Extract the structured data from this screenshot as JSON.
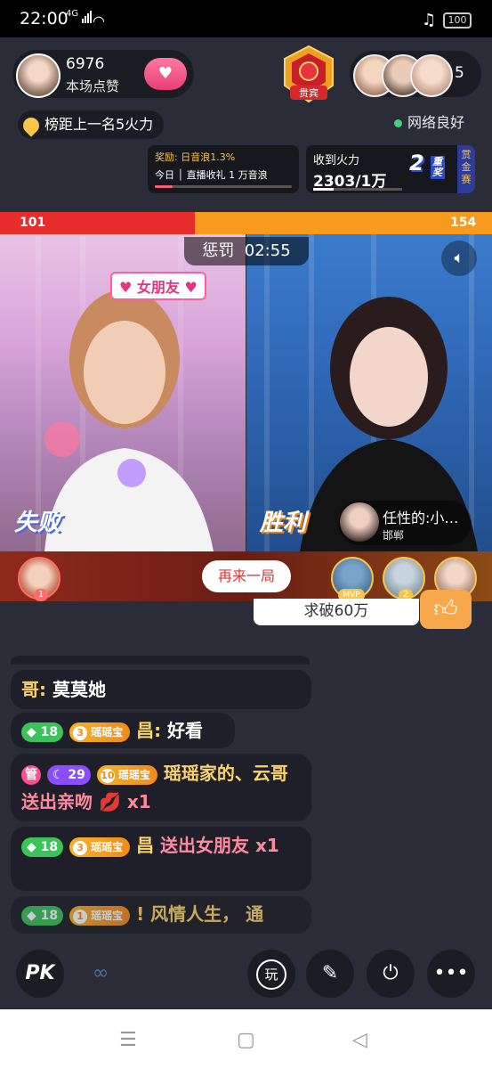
{
  "status_bar": {
    "time": "22:00",
    "network": "4G",
    "battery": "100"
  },
  "host": {
    "likes": "6976",
    "likes_label": "本场点赞"
  },
  "rank_badge": {
    "label": "贵宾"
  },
  "viewers": {
    "count": "5"
  },
  "fire_gap": "榜距上一名5火力",
  "network_status": "网络良好",
  "reward_card": {
    "line1": "奖励: 日音浪1.3%",
    "line2_a": "今日",
    "line2_b": "直播收礼 1 万音浪",
    "progress": 0.13
  },
  "fire_card": {
    "label": "收到火力",
    "value": "2303/1万",
    "double_label": "2",
    "double_suffix": "重奖",
    "bounty_label": "赏金赛",
    "progress": 0.23
  },
  "pk": {
    "left_score": "101",
    "right_score": "154",
    "penalty_label": "惩罚",
    "timer": "02:55"
  },
  "left_video": {
    "tag": "女朋友",
    "stamp": "失败"
  },
  "right_video": {
    "stamp": "胜利",
    "mvp_name": "任性的:小…",
    "mvp_location": "邯郸",
    "mvp_badge": "MVP"
  },
  "result_bar": {
    "rematch_label": "再来一局",
    "left_rank": "1",
    "winners": [
      "1",
      "2",
      "3"
    ]
  },
  "target_banner": "求破60万",
  "chat": [
    {
      "name": "哥:",
      "text": " 莫莫她"
    },
    {
      "level": "18",
      "fan_level": "3",
      "fan_name": "瑶瑶宝",
      "name": "昌:",
      "text": " 好看"
    },
    {
      "admin": "管",
      "level": "29",
      "fan_level": "10",
      "fan_name": "瑶瑶宝",
      "name": "瑶瑶家的、云哥",
      "gift": " 送出亲吻 💋 x1"
    },
    {
      "level": "18",
      "fan_level": "3",
      "fan_name": "瑶瑶宝",
      "name": "昌",
      "gift": " 送出女朋友 x1"
    },
    {
      "level": "18",
      "fan_level": "1",
      "fan_name": "瑶瑶宝",
      "name": "! 风情人生，",
      "text": " 通"
    }
  ],
  "toolbar": {
    "pk": "PK",
    "play": "玩"
  }
}
